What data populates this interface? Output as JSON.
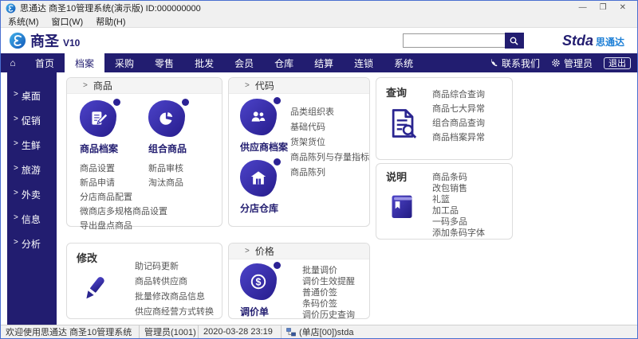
{
  "ui": {
    "arrow": ">",
    "window_controls": {
      "minimize": "—",
      "maximize": "❐",
      "close": "✕"
    },
    "home_glyph": "⌂"
  },
  "titlebar": {
    "title": "思通达 商圣10管理系统(演示版) ID:000000000"
  },
  "menubar": {
    "items": [
      "系统(M)",
      "窗口(W)",
      "帮助(H)"
    ]
  },
  "header": {
    "logo_text": "商圣",
    "logo_version": "V10",
    "brand_en": "Stda",
    "brand_cn": "思通达",
    "search_placeholder": ""
  },
  "nav": {
    "tabs": [
      {
        "label": "首页"
      },
      {
        "label": "档案"
      },
      {
        "label": "采购"
      },
      {
        "label": "零售"
      },
      {
        "label": "批发"
      },
      {
        "label": "会员"
      },
      {
        "label": "仓库"
      },
      {
        "label": "结算"
      },
      {
        "label": "连锁"
      },
      {
        "label": "系统"
      }
    ],
    "active_tab": "档案",
    "contact": "联系我们",
    "admin": "管理员",
    "logout": "退出"
  },
  "sidebar": {
    "items": [
      "桌面",
      "促销",
      "生鲜",
      "旅游",
      "外卖",
      "信息",
      "分析"
    ]
  },
  "cards": {
    "goods": {
      "header": "商品",
      "apps": [
        {
          "name": "商品档案"
        },
        {
          "name": "组合商品"
        }
      ],
      "links_left": [
        "商品设置",
        "新品申请",
        "分店商品配置",
        "微商店多规格商品设置",
        "导出盘点商品"
      ],
      "links_right": [
        "新品审核",
        "淘汰商品"
      ]
    },
    "codes": {
      "header": "代码",
      "apps": [
        {
          "name": "供应商档案"
        },
        {
          "name": "分店仓库"
        }
      ],
      "links": [
        "品类组织表",
        "基础代码",
        "货架货位",
        "商品陈列与存量指标",
        "商品陈列"
      ]
    },
    "query": {
      "title": "查询",
      "links": [
        "商品综合查询",
        "商品七大异常",
        "组合商品查询",
        "商品档案异常"
      ]
    },
    "notes": {
      "title": "说明",
      "links": [
        "商品条码",
        "改包销售",
        "礼篮",
        "加工品",
        "一码多品",
        "添加条码字体"
      ]
    },
    "modify": {
      "title": "修改",
      "links": [
        "助记码更新",
        "商品转供应商",
        "批量修改商品信息",
        "供应商经营方式转换"
      ]
    },
    "price": {
      "header": "价格",
      "app": {
        "name": "调价单"
      },
      "links": [
        "批量调价",
        "调价生效提醒",
        "普通价签",
        "条码价签",
        "调价历史查询"
      ]
    }
  },
  "statusbar": {
    "welcome": "欢迎使用思通达 商圣10管理系统",
    "user": "管理员(1001)",
    "datetime": "2020-03-28 23:19",
    "store": "(单店[00])stda"
  },
  "colors": {
    "navy": "#221d70",
    "icon_purple": "#352db0",
    "brand_blue": "#1d7fd6",
    "link_gray": "#555555",
    "active_tab_bg": "#ffffff"
  }
}
